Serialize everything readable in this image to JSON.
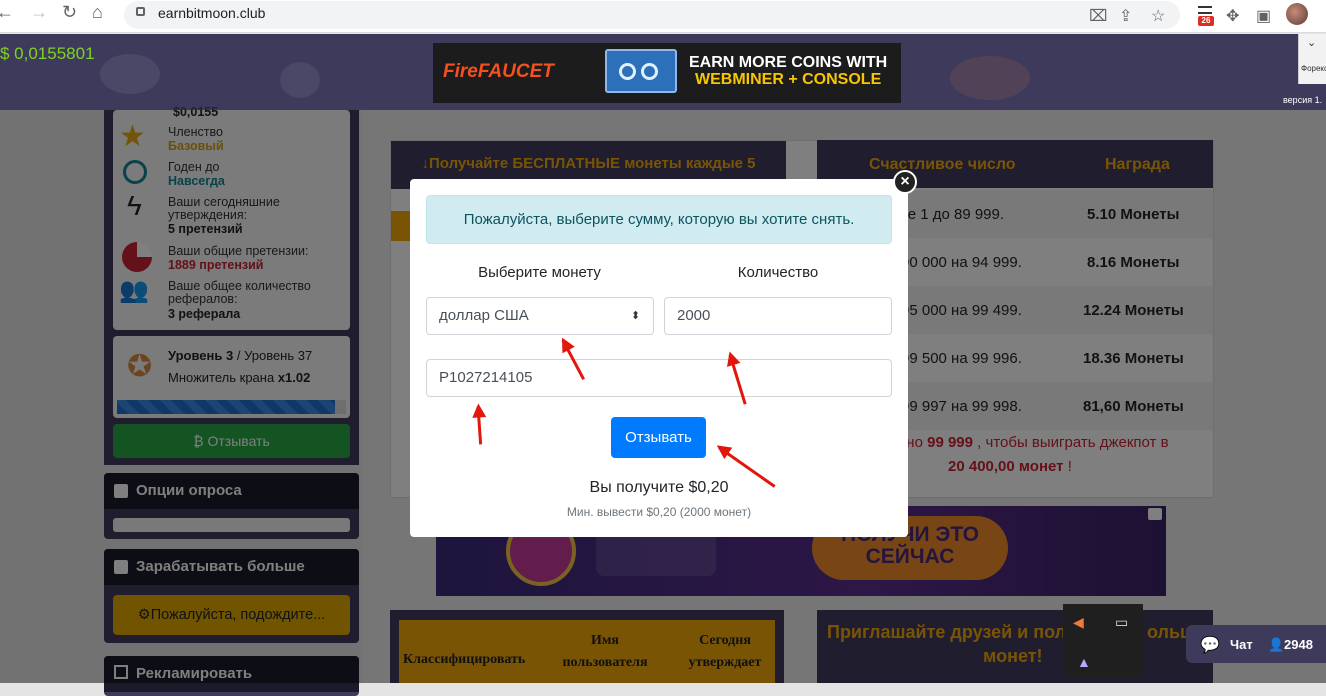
{
  "browser": {
    "url": "earnbitmoon.club",
    "extension_badge": "26"
  },
  "header": {
    "balance": "$ 0,0155801",
    "banner": {
      "brand": "FireFAUCET",
      "line1": "EARN MORE COINS WITH",
      "line2": "WEBMINER + CONSOLE"
    },
    "language_label": "Форекс",
    "version": "версия 1."
  },
  "sidebar": {
    "stats_top_partial": "$0,0155",
    "stats": [
      {
        "label": "Членство",
        "value": "Базовый",
        "color": "#d4a017"
      },
      {
        "label": "Годен до",
        "value": "Навсегда",
        "color": "#17a2b8"
      },
      {
        "label": "Ваши сегодняшние утверждения:",
        "value": "5 претензий",
        "color": "#212529"
      },
      {
        "label": "Ваши общие претензии:",
        "value": "1889 претензий",
        "color": "#c82333"
      },
      {
        "label": "Ваше общее количество рефералов:",
        "value": "3 реферала",
        "color": "#212529"
      }
    ],
    "level": {
      "current": "Уровень 3",
      "separator": " / ",
      "max": "Уровень 37",
      "multiplier_label": "Множитель крана",
      "multiplier_value": "x1.02",
      "progress": 0.95
    },
    "withdraw_button": "Отзывать",
    "panels": [
      {
        "title": "Опции опроса"
      },
      {
        "title": "Зарабатывать больше",
        "button": "Пожалуйста, подождите..."
      },
      {
        "title": "Рекламировать"
      }
    ]
  },
  "main": {
    "faucet_title": "Получайте БЕСПЛАТНЫЕ монеты каждые 5",
    "lucky_table": {
      "headers": [
        "Счастливое число",
        "Награда"
      ],
      "rows": [
        {
          "range": "те 1 до 89 999.",
          "reward": "5.10 Монеты"
        },
        {
          "range": "90 000 на 94 999.",
          "reward": "8.16 Монеты"
        },
        {
          "range": "95 000 на 99 499.",
          "reward": "12.24 Монеты"
        },
        {
          "range": "99 500 на 99 996.",
          "reward": "18.36 Монеты"
        },
        {
          "range": "99 997 на 99 998.",
          "reward": "81,60 Монеты"
        }
      ],
      "jackpot_prefix": "овно",
      "jackpot_number": "99 999",
      "jackpot_middle": ", чтобы выиграть джекпот в",
      "jackpot_amount": "20 400,00 монет",
      "jackpot_suffix": "!"
    },
    "ad": {
      "cta": "ПОЛУЧИ ЭТО СЕЙЧАС"
    },
    "leaderboard": {
      "headers": [
        "Классифицировать",
        "Имя пользователя",
        "Сегодня утверждает"
      ]
    },
    "invite": {
      "title_line1": "Приглашайте друзей и пол",
      "title_tail": "ольш",
      "title_line2": "монет!"
    }
  },
  "modal": {
    "alert": "Пожалуйста, выберите сумму, которую вы хотите снять.",
    "coin_label": "Выберите монету",
    "amount_label": "Количество",
    "coin_value": "доллар США",
    "amount_value": "2000",
    "wallet_value": "P1027214105",
    "submit": "Отзывать",
    "receive": "Вы получите $0,20",
    "min_withdraw": "Мин. вывести $0,20 (2000 монет)"
  },
  "chat": {
    "label": "Чат",
    "online": "2948"
  }
}
